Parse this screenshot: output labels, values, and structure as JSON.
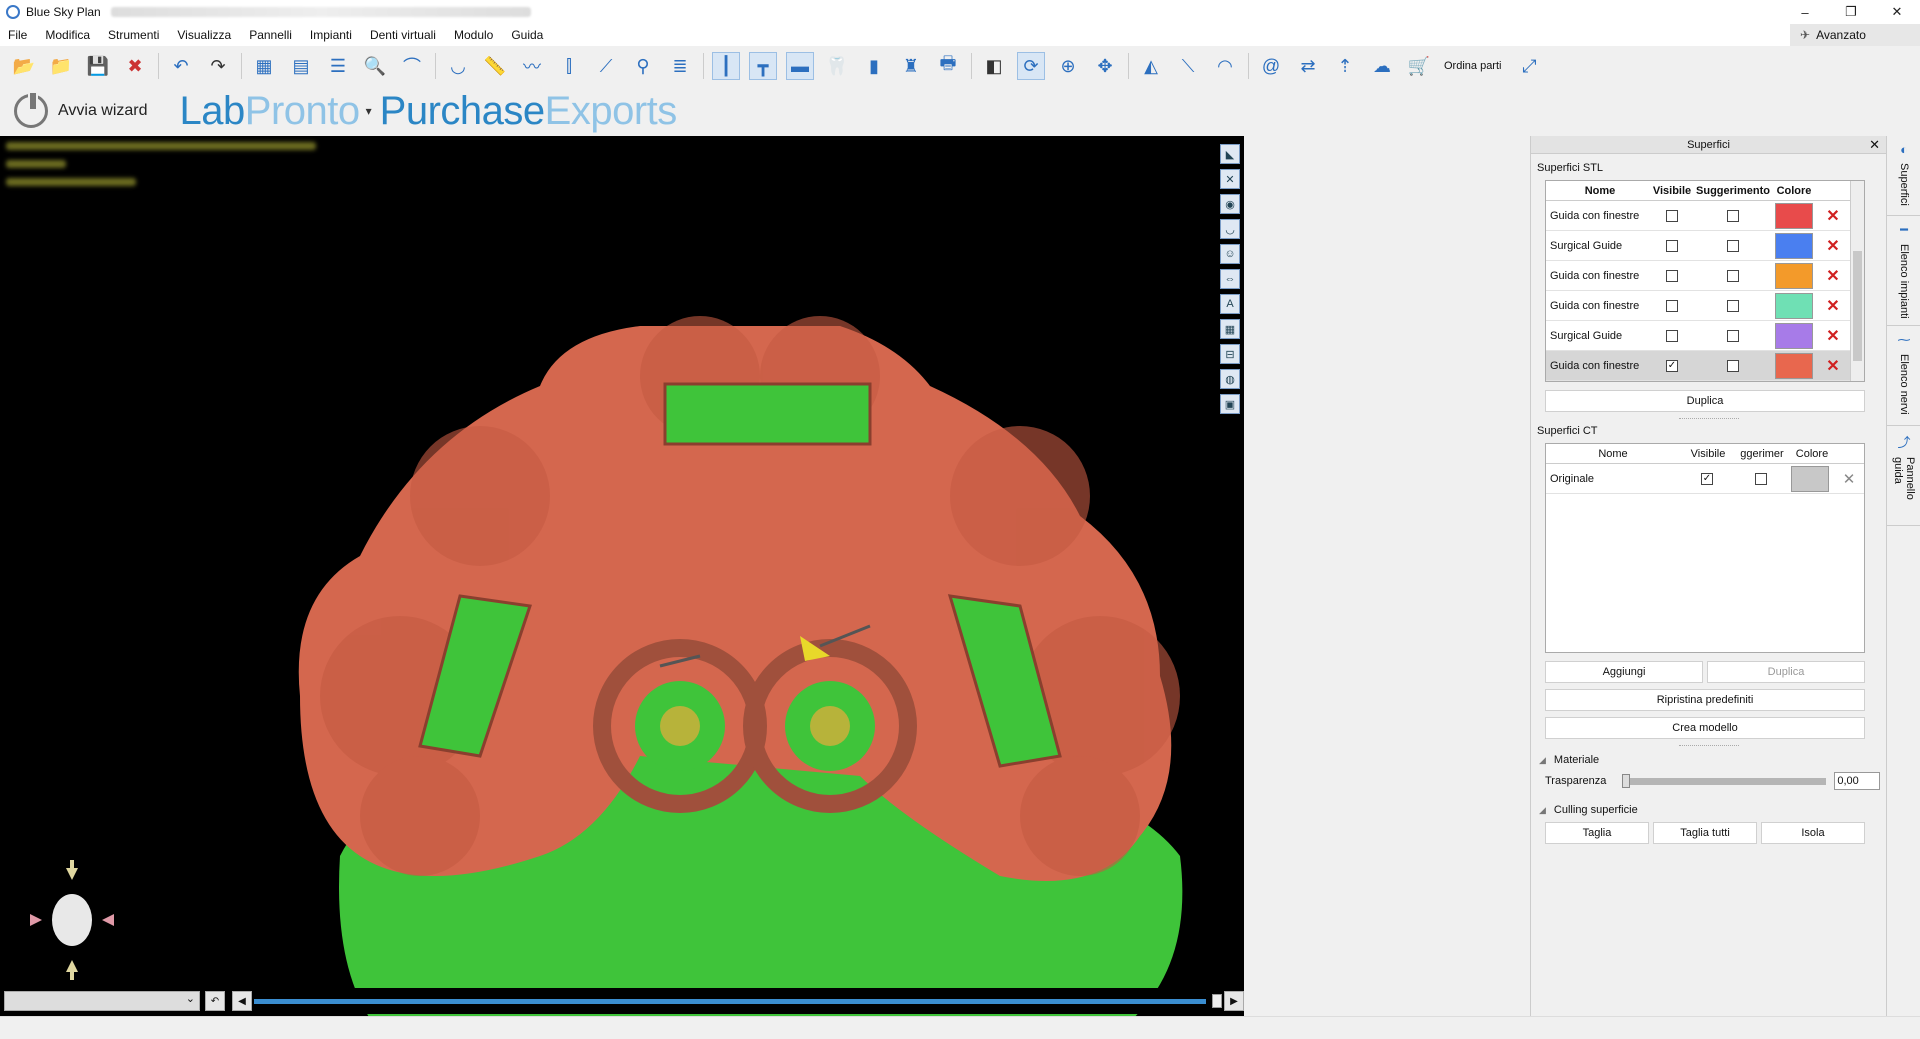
{
  "window": {
    "title": "Blue Sky Plan",
    "controls": [
      "–",
      "❐",
      "✕"
    ]
  },
  "menu": [
    "File",
    "Modifica",
    "Strumenti",
    "Visualizza",
    "Pannelli",
    "Impianti",
    "Denti virtuali",
    "Modulo",
    "Guida"
  ],
  "advanced_label": "Avanzato",
  "toolbar": {
    "order_parts_label": "Ordina parti"
  },
  "wizard": {
    "label": "Avvia wizard"
  },
  "logos": {
    "lab_a": "Lab",
    "lab_b": "Pronto",
    "purchase_a": "Purchase",
    "purchase_b": "Exports"
  },
  "panel": {
    "title": "Superfici",
    "stl_label": "Superfici STL",
    "stl_headers": {
      "name": "Nome",
      "visible": "Visibile",
      "hint": "Suggerimento",
      "color": "Colore"
    },
    "stl_rows": [
      {
        "name": "Guida con finestre",
        "visible": "",
        "hint": "",
        "color": "#e84b4b"
      },
      {
        "name": "Surgical Guide",
        "visible": "",
        "hint": "",
        "color": "#4a7ff0"
      },
      {
        "name": "Guida con finestre",
        "visible": "",
        "hint": "",
        "color": "#f39a2a"
      },
      {
        "name": "Guida con finestre",
        "visible": "",
        "hint": "",
        "color": "#6fe0b4"
      },
      {
        "name": "Surgical Guide",
        "visible": "",
        "hint": "",
        "color": "#a77be8"
      },
      {
        "name": "Guida con finestre",
        "visible": "✓",
        "hint": "",
        "color": "#e8674e"
      }
    ],
    "duplicate_label": "Duplica",
    "ct_label": "Superfici CT",
    "ct_headers": {
      "name": "Nome",
      "visible": "Visibile",
      "hint": "ggerimer",
      "color": "Colore"
    },
    "ct_rows": [
      {
        "name": "Originale",
        "visible": "✓",
        "hint": "",
        "color": "#c8c8c8"
      }
    ],
    "add_label": "Aggiungi",
    "duplicate2_label": "Duplica",
    "restore_label": "Ripristina predefiniti",
    "create_model_label": "Crea modello",
    "material_label": "Materiale",
    "transparency_label": "Trasparenza",
    "transparency_value": "0,00",
    "culling_label": "Culling superficie",
    "cut_label": "Taglia",
    "cut_all_label": "Taglia tutti",
    "isolate_label": "Isola"
  },
  "side_tabs": [
    "Superfici",
    "Elenco impianti",
    "Elenco nervi",
    "Pannello guida"
  ],
  "colors": {
    "accent": "#2b86c5",
    "gum": "#3fc43a",
    "guide": "#d4674e"
  }
}
